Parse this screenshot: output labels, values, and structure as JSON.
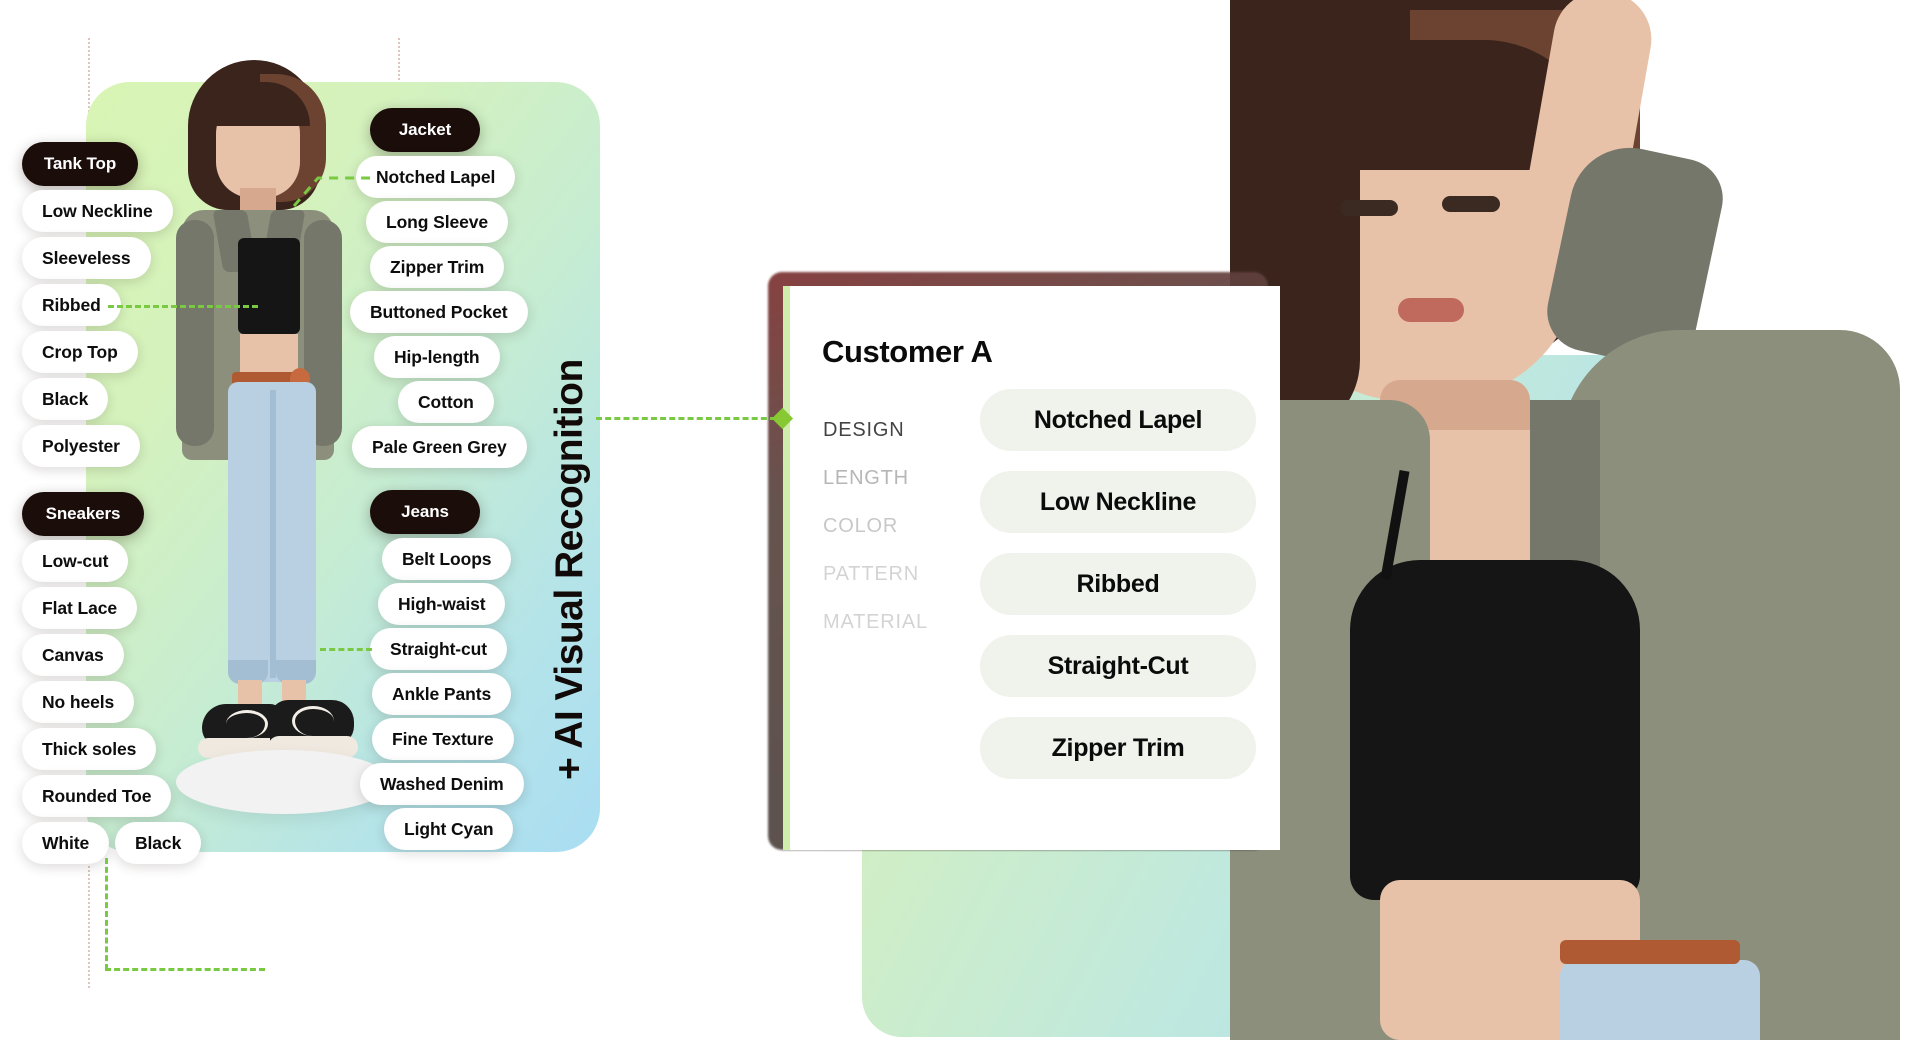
{
  "headline": "+ AI Visual Recognition",
  "groups": [
    {
      "name": "tank-top",
      "header": "Tank Top",
      "tags": [
        "Low Neckline",
        "Sleeveless",
        "Ribbed",
        "Crop Top",
        "Black",
        "Polyester"
      ]
    },
    {
      "name": "jacket",
      "header": "Jacket",
      "tags": [
        "Notched Lapel",
        "Long Sleeve",
        "Zipper Trim",
        "Buttoned Pocket",
        "Hip-length",
        "Cotton",
        "Pale Green Grey"
      ]
    },
    {
      "name": "sneakers",
      "header": "Sneakers",
      "tags": [
        "Low-cut",
        "Flat Lace",
        "Canvas",
        "No heels",
        "Thick soles",
        "Rounded Toe",
        "White",
        "Black"
      ]
    },
    {
      "name": "jeans",
      "header": "Jeans",
      "tags": [
        "Belt Loops",
        "High-waist",
        "Straight-cut",
        "Ankle Pants",
        "Fine Texture",
        "Washed Denim",
        "Light Cyan"
      ]
    }
  ],
  "card": {
    "title": "Customer A",
    "attribute_labels": [
      "DESIGN",
      "LENGTH",
      "COLOR",
      "PATTERN",
      "MATERIAL"
    ],
    "values": [
      "Notched Lapel",
      "Low Neckline",
      "Ribbed",
      "Straight-Cut",
      "Zipper Trim"
    ]
  },
  "colors": {
    "accent_green": "#7ac943",
    "diamond_green": "#86c933",
    "pill_bg": "#ffffff",
    "pill_header_bg": "#1a0d0a",
    "card_bg": "#ffffff",
    "value_pill_bg": "#f0f3ec",
    "panel_gradient_start": "#d9f5b4",
    "panel_gradient_end": "#a9ddf2"
  }
}
